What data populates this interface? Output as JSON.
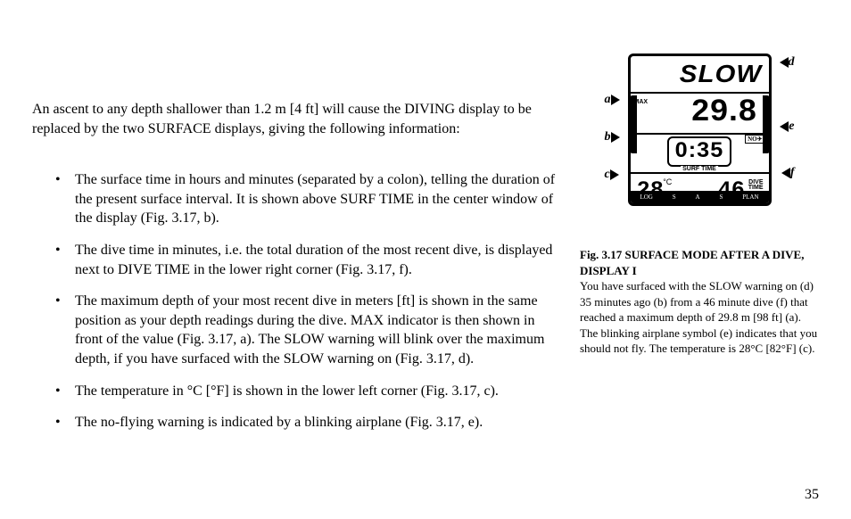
{
  "main": {
    "intro": "An ascent to any depth shallower than 1.2 m [4 ft] will cause the DIVING display to be replaced by the two SURFACE displays, giving the following information:",
    "bullets": [
      "The surface time in hours and minutes (separated by a colon), telling the duration of the present surface interval. It is shown above SURF TIME in the center window of the display (Fig. 3.17, b).",
      "The dive time in minutes, i.e. the total duration of the most recent dive, is displayed next to DIVE TIME in the lower right corner (Fig. 3.17, f).",
      "The maximum depth of your most recent dive in meters [ft] is shown in the same position as your depth readings during the dive. MAX indicator is then shown in front of the value (Fig. 3.17, a). The SLOW warning will blink over the maximum depth, if you have surfaced with the SLOW warning on (Fig. 3.17, d).",
      "The temperature in °C [°F] is shown in the lower left corner (Fig. 3.17, c).",
      "The no-flying warning is indicated by a blinking airplane (Fig. 3.17, e)."
    ]
  },
  "figure": {
    "top_warning": "SLOW",
    "max_label": "MAX",
    "depth_value": "29.8",
    "surf_time_value": "0:35",
    "surf_time_label": "SURF TIME",
    "no_fly_label": "NO✈",
    "temperature_value": "28",
    "temperature_unit": "°C",
    "dive_time_value": "46",
    "dive_time_label_l1": "DIVE",
    "dive_time_label_l2": "TIME",
    "footer_modes": [
      "LOG",
      "S",
      "A",
      "S",
      "PLAN"
    ],
    "callouts": {
      "a": "a",
      "b": "b",
      "c": "c",
      "d": "d",
      "e": "e",
      "f": "f"
    }
  },
  "caption": {
    "title": "Fig. 3.17 SURFACE MODE AFTER A DIVE, DISPLAY I",
    "body": "You have surfaced with the SLOW warning on (d) 35 minutes ago (b) from a 46 minute dive (f) that reached a maximum depth of 29.8 m [98 ft] (a). The blinking airplane symbol (e) indicates that you should not fly. The temperature is 28°C [82°F] (c)."
  },
  "page_number": "35"
}
